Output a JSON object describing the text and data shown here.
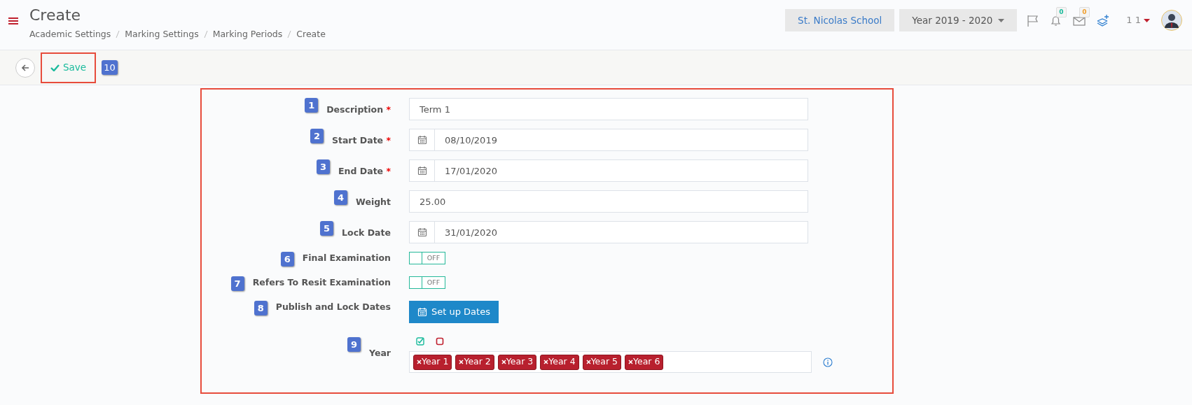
{
  "header": {
    "title": "Create",
    "breadcrumbs": [
      "Academic Settings",
      "Marking Settings",
      "Marking Periods",
      "Create"
    ],
    "school": "St. Nicolas School",
    "year_selector": "Year 2019 - 2020",
    "notifications": "0",
    "messages": "0",
    "user": "1 1"
  },
  "toolbar": {
    "save_label": "Save",
    "step": "10"
  },
  "fields": [
    {
      "kind": "text",
      "step": "1",
      "label": "Description",
      "required_mark": "*",
      "value": "Term 1"
    },
    {
      "kind": "date",
      "step": "2",
      "label": "Start Date",
      "required_mark": "*",
      "value": "08/10/2019"
    },
    {
      "kind": "date",
      "step": "3",
      "label": "End Date",
      "required_mark": "*",
      "value": "17/01/2020"
    },
    {
      "kind": "text",
      "step": "4",
      "label": "Weight",
      "value": "25.00"
    },
    {
      "kind": "date",
      "step": "5",
      "label": "Lock Date",
      "value": "31/01/2020"
    },
    {
      "kind": "toggle",
      "step": "6",
      "label": "Final Examination",
      "on": false,
      "state_label": "OFF"
    },
    {
      "kind": "toggle",
      "step": "7",
      "label": "Refers To Resit Examination",
      "on": false,
      "state_label": "OFF"
    },
    {
      "kind": "button",
      "step": "8",
      "label": "Publish and Lock Dates",
      "button_label": "Set up Dates"
    },
    {
      "kind": "tags",
      "step": "9",
      "label": "Year",
      "tags": [
        "Year 1",
        "Year 2",
        "Year 3",
        "Year 4",
        "Year 5",
        "Year 6"
      ]
    }
  ]
}
